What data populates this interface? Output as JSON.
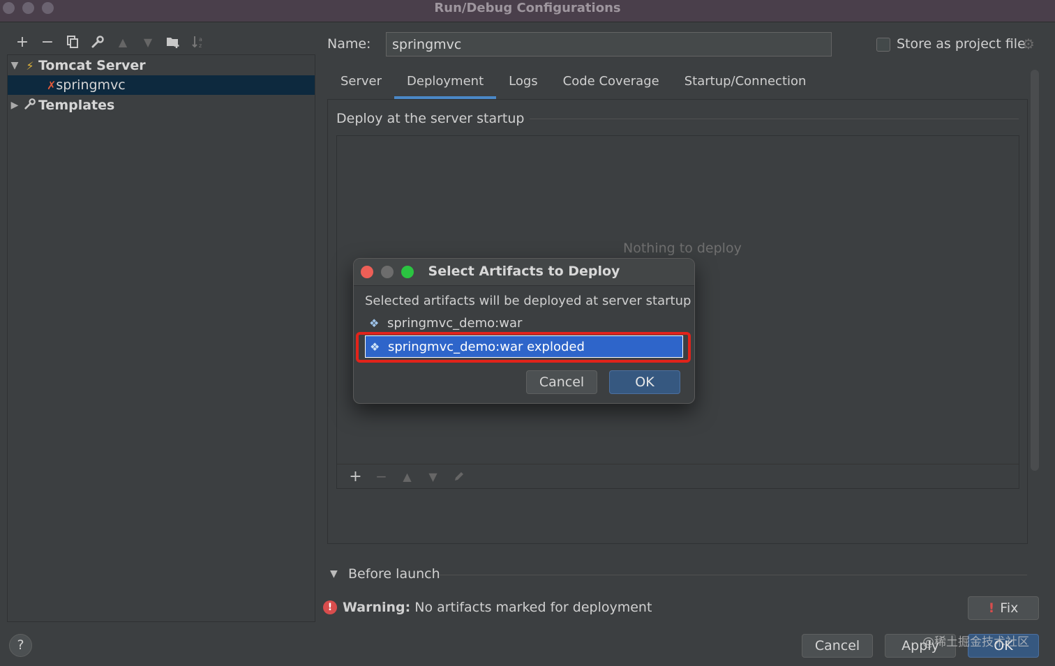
{
  "window": {
    "title": "Run/Debug Configurations"
  },
  "toolbar": {
    "add": "+",
    "remove": "−"
  },
  "tree": {
    "root": "Tomcat Server",
    "child": "springmvc",
    "templates": "Templates"
  },
  "name_field": {
    "label": "Name:",
    "value": "springmvc"
  },
  "store": {
    "label": "Store as project file"
  },
  "tabs": [
    {
      "label": "Server"
    },
    {
      "label": "Deployment"
    },
    {
      "label": "Logs"
    },
    {
      "label": "Code Coverage"
    },
    {
      "label": "Startup/Connection"
    }
  ],
  "deploy": {
    "section_title": "Deploy at the server startup",
    "empty_text": "Nothing to deploy"
  },
  "before_launch": {
    "label": "Before launch"
  },
  "warning": {
    "prefix": "Warning:",
    "text": " No artifacts marked for deployment"
  },
  "buttons": {
    "fix": "Fix",
    "cancel": "Cancel",
    "apply": "Apply",
    "ok": "OK",
    "help": "?"
  },
  "dialog": {
    "title": "Select Artifacts to Deploy",
    "subtitle": "Selected artifacts will be deployed at server startup",
    "artifacts": [
      {
        "label": "springmvc_demo:war"
      },
      {
        "label": "springmvc_demo:war exploded"
      }
    ],
    "cancel": "Cancel",
    "ok": "OK"
  },
  "watermark": "@稀土掘金技术社区"
}
